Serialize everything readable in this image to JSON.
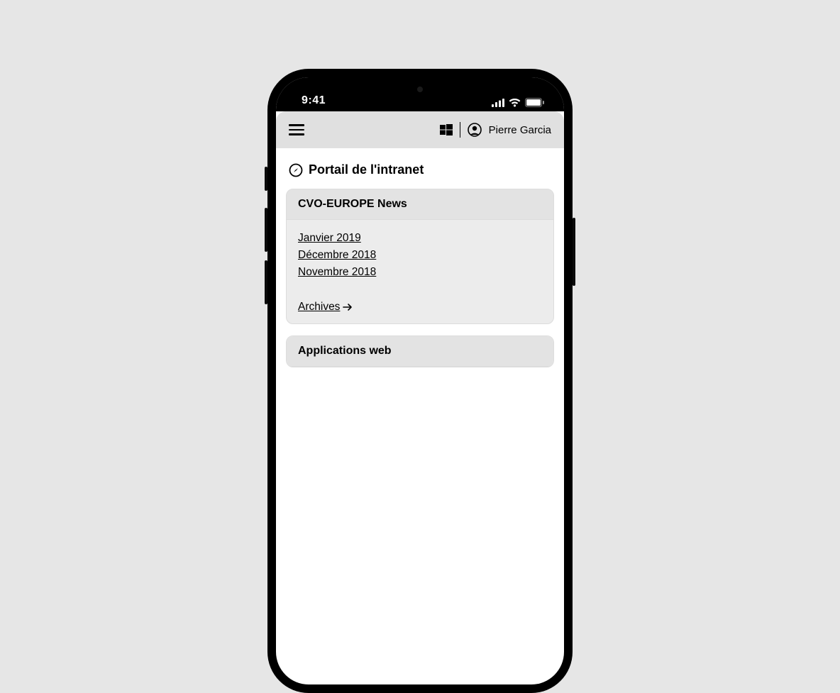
{
  "status": {
    "time": "9:41"
  },
  "header": {
    "user_name": "Pierre Garcia"
  },
  "page": {
    "title": "Portail de l'intranet"
  },
  "news_card": {
    "title": "CVO-EUROPE News",
    "items": [
      {
        "label": "Janvier 2019"
      },
      {
        "label": "Décembre 2018"
      },
      {
        "label": "Novembre 2018"
      }
    ],
    "archives_label": "Archives"
  },
  "apps_card": {
    "title": "Applications web"
  }
}
